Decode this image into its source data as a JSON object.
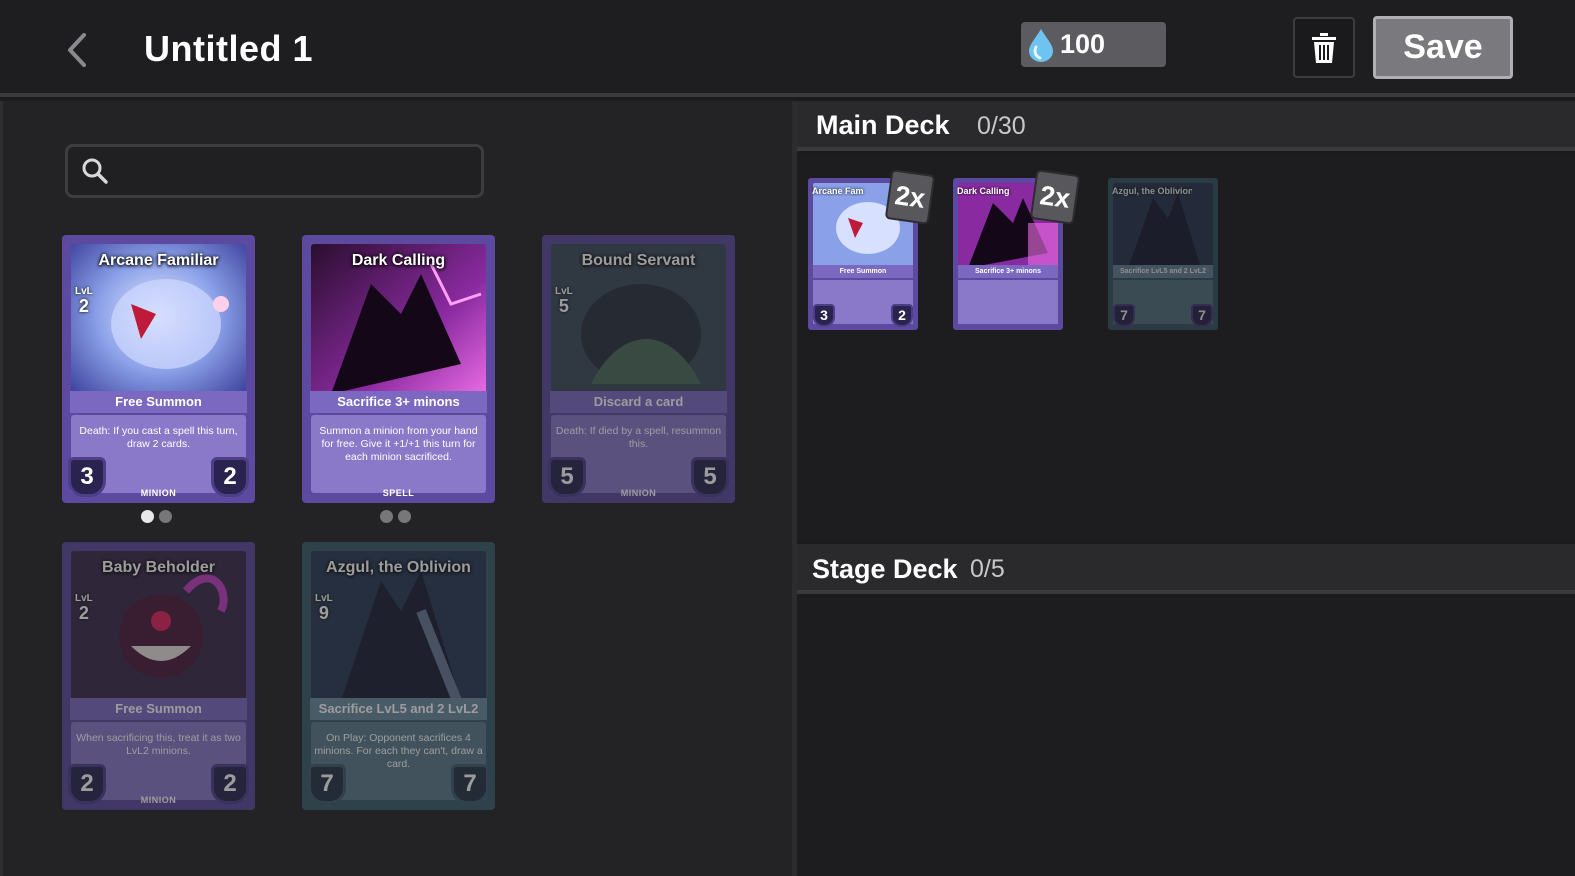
{
  "header": {
    "title": "Untitled 1",
    "mana": "100",
    "save_label": "Save"
  },
  "search": {
    "placeholder": "",
    "value": ""
  },
  "cards": [
    {
      "name": "Arcane Familiar",
      "lvl_label": "LvL",
      "lvl": "2",
      "strip": "Free Summon",
      "text": "Death: If you cast a spell this turn, draw 2 cards.",
      "cost": "3",
      "power": "2",
      "type": "MINION",
      "dim": false
    },
    {
      "name": "Dark Calling",
      "lvl_label": "",
      "lvl": "",
      "strip": "Sacrifice 3+ minons",
      "text": "Summon a minion from your hand for free. Give it +1/+1 this turn for each minion sacrificed.",
      "cost": "",
      "power": "",
      "type": "SPELL",
      "dim": false
    },
    {
      "name": "Bound Servant",
      "lvl_label": "LvL",
      "lvl": "5",
      "strip": "Discard a card",
      "text": "Death: If died by a spell, resummon this.",
      "cost": "5",
      "power": "5",
      "type": "MINION",
      "dim": true
    },
    {
      "name": "Baby Beholder",
      "lvl_label": "LvL",
      "lvl": "2",
      "strip": "Free Summon",
      "text": "When sacrificing this, treat it as two LvL2 minions.",
      "cost": "2",
      "power": "2",
      "type": "MINION",
      "dim": true
    },
    {
      "name": "Azgul, the Oblivion",
      "lvl_label": "LvL",
      "lvl": "9",
      "strip": "Sacrifice LvL5 and 2 LvL2",
      "text": "On Play: Opponent sacrifices 4 minions. For each they can't, draw a card.",
      "cost": "7",
      "power": "7",
      "type": "",
      "dim": true
    }
  ],
  "main_deck": {
    "title": "Main Deck",
    "count": "0/30",
    "cards": [
      {
        "name": "Arcane Fam",
        "copies": "2x",
        "strip": "Free Summon",
        "cost": "3",
        "power": "2"
      },
      {
        "name": "Dark Calling",
        "copies": "2x",
        "strip": "Sacrifice 3+ minons",
        "cost": "",
        "power": ""
      },
      {
        "name": "Azgul, the Oblivion",
        "copies": "",
        "strip": "Sacrifice LvL5 and 2 LvL2",
        "cost": "7",
        "power": "7"
      }
    ]
  },
  "stage_deck": {
    "title": "Stage Deck",
    "count": "0/5"
  }
}
